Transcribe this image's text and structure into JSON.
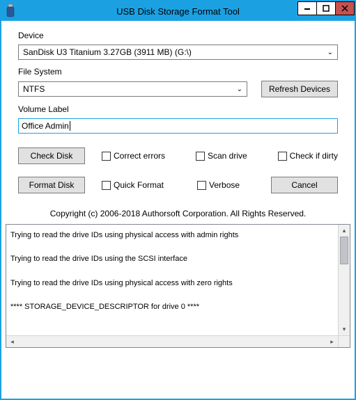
{
  "window": {
    "title": "USB Disk Storage Format Tool"
  },
  "labels": {
    "device": "Device",
    "file_system": "File System",
    "volume_label": "Volume Label"
  },
  "device": {
    "selected": "SanDisk U3 Titanium 3.27GB (3911 MB)  (G:\\)"
  },
  "file_system": {
    "selected": "NTFS"
  },
  "buttons": {
    "refresh": "Refresh Devices",
    "check_disk": "Check Disk",
    "format_disk": "Format Disk",
    "cancel": "Cancel"
  },
  "volume_label_value": "Office Admin",
  "checks": {
    "correct_errors": "Correct errors",
    "scan_drive": "Scan drive",
    "check_if_dirty": "Check if dirty",
    "quick_format": "Quick Format",
    "verbose": "Verbose"
  },
  "copyright": "Copyright (c) 2006-2018 Authorsoft Corporation. All Rights Reserved.",
  "log": {
    "lines": [
      "Trying to read the drive IDs using physical access with admin rights",
      "Trying to read the drive IDs using the SCSI interface",
      "Trying to read the drive IDs using physical access with zero rights",
      "**** STORAGE_DEVICE_DESCRIPTOR for drive 0 ****"
    ]
  }
}
